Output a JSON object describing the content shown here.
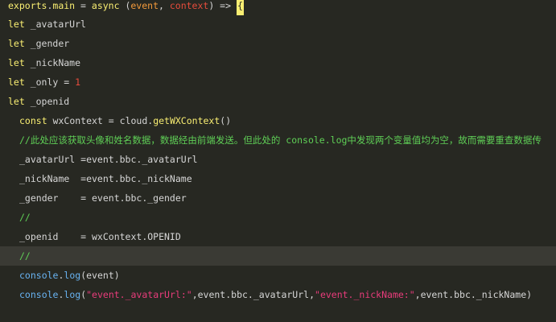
{
  "code": {
    "line1": {
      "exports": "exports",
      "dot": ".",
      "main": "main",
      "eq": " = ",
      "async": "async",
      "paren_open": " (",
      "event": "event",
      "comma": ", ",
      "context": "context",
      "arrow": ") => ",
      "brace": "{"
    },
    "line2": {
      "let": "let",
      "name": " _avatarUrl"
    },
    "line3": {
      "let": "let",
      "name": " _gender"
    },
    "line4": {
      "let": "let",
      "name": " _nickName"
    },
    "line5": {
      "let": "let",
      "name": " _only = ",
      "value": "1"
    },
    "line6": {
      "let": "let",
      "name": " _openid"
    },
    "line7": {
      "const": "const",
      "name": " wxContext = ",
      "cloud": "cloud.",
      "fn": "getWXContext",
      "parens": "()"
    },
    "line8": {
      "comment": "//此处应该获取头像和姓名数据，数据经由前端发送。但此处的 console.log中发现两个变量值均为空，故而需要重查数据传"
    },
    "line9": {
      "text": "_avatarUrl =event.bbc._avatarUrl"
    },
    "line10": {
      "text": "_nickName  =event.bbc._nickName"
    },
    "line11": {
      "text": "_gender    = event.bbc._gender"
    },
    "line12": {
      "comment": "//"
    },
    "line13": {
      "text": "_openid    = wxContext.OPENID"
    },
    "line14": {
      "comment": "//"
    },
    "line15": {
      "console": "console",
      "dot": ".",
      "log": "log",
      "open": "(",
      "arg": "event",
      "close": ")"
    },
    "line16": {
      "console": "console",
      "dot": ".",
      "log": "log",
      "open": "(",
      "str1": "\"event._avatarUrl:\"",
      "mid1": ",event.bbc._avatarUrl,",
      "str2": "\"event._nickName:\"",
      "mid2": ",event.bbc._nickName",
      "close": ")"
    }
  }
}
